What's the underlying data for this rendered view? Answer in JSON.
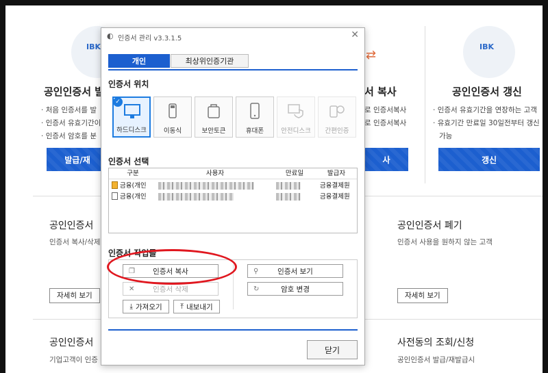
{
  "background": {
    "left_card": {
      "title": "공인인증서 발",
      "bullets": [
        "처음 인증서를 발",
        "인증서 유효기간이",
        "인증서 암호를 분"
      ],
      "button": "발급/재"
    },
    "mid_card": {
      "title": "서 복사",
      "bullets": [
        "로 인증서복사",
        "로 인증서복사"
      ],
      "button": "사"
    },
    "right_card": {
      "title": "공인인증서 갱신",
      "bullets": [
        "인증서 유효기간을 연장하는 고객",
        "유효기간 만료일 30일전부터 갱신",
        "가능"
      ],
      "button": "갱신"
    },
    "sections": {
      "left_title": "공인인증서 ",
      "left_sub": "인증서 복사/삭제",
      "left_detail": "자세히 보기",
      "right_title": "공인인증서 폐기",
      "right_sub": "인증서 사용을 원하지 않는 고객",
      "right_detail": "자세히 보기",
      "bottom_left_title": "공인인증서 ",
      "bottom_left_sub": "기업고객이 인증",
      "bottom_right_title": "사전동의 조회/신청",
      "bottom_right_sub": "공인인증서 발급/재발급시"
    },
    "ibk": "IBK"
  },
  "dialog": {
    "title": "인증서 관리 v3.3.1.5",
    "tabs": [
      "개인",
      "최상위인증기관"
    ],
    "location_title": "인증서 위치",
    "locations": [
      {
        "label": "하드디스크",
        "icon": "monitor-icon",
        "selected": true,
        "disabled": false
      },
      {
        "label": "이동식",
        "icon": "usb-icon",
        "selected": false,
        "disabled": false
      },
      {
        "label": "보안토큰",
        "icon": "token-icon",
        "selected": false,
        "disabled": false
      },
      {
        "label": "휴대폰",
        "icon": "phone-icon",
        "selected": false,
        "disabled": false
      },
      {
        "label": "안전디스크",
        "icon": "safe-disk-icon",
        "selected": false,
        "disabled": true
      },
      {
        "label": "간편인증",
        "icon": "simple-auth-icon",
        "selected": false,
        "disabled": true
      }
    ],
    "select_title": "인증서 선택",
    "table": {
      "headers": [
        "구분",
        "사용자",
        "만료일",
        "발급자"
      ],
      "rows": [
        {
          "type": "금융(개인",
          "issuer": "금융결제원"
        },
        {
          "type": "금융(개인",
          "issuer": "금융결제원"
        }
      ]
    },
    "ops_title": "인증서 작업들",
    "ops": {
      "copy": "인증서 복사",
      "delete": "인증서 삭제",
      "import": "가져오기",
      "export": "내보내기",
      "view": "인증서 보기",
      "change_pw": "암호 변경"
    },
    "close": "닫기"
  }
}
